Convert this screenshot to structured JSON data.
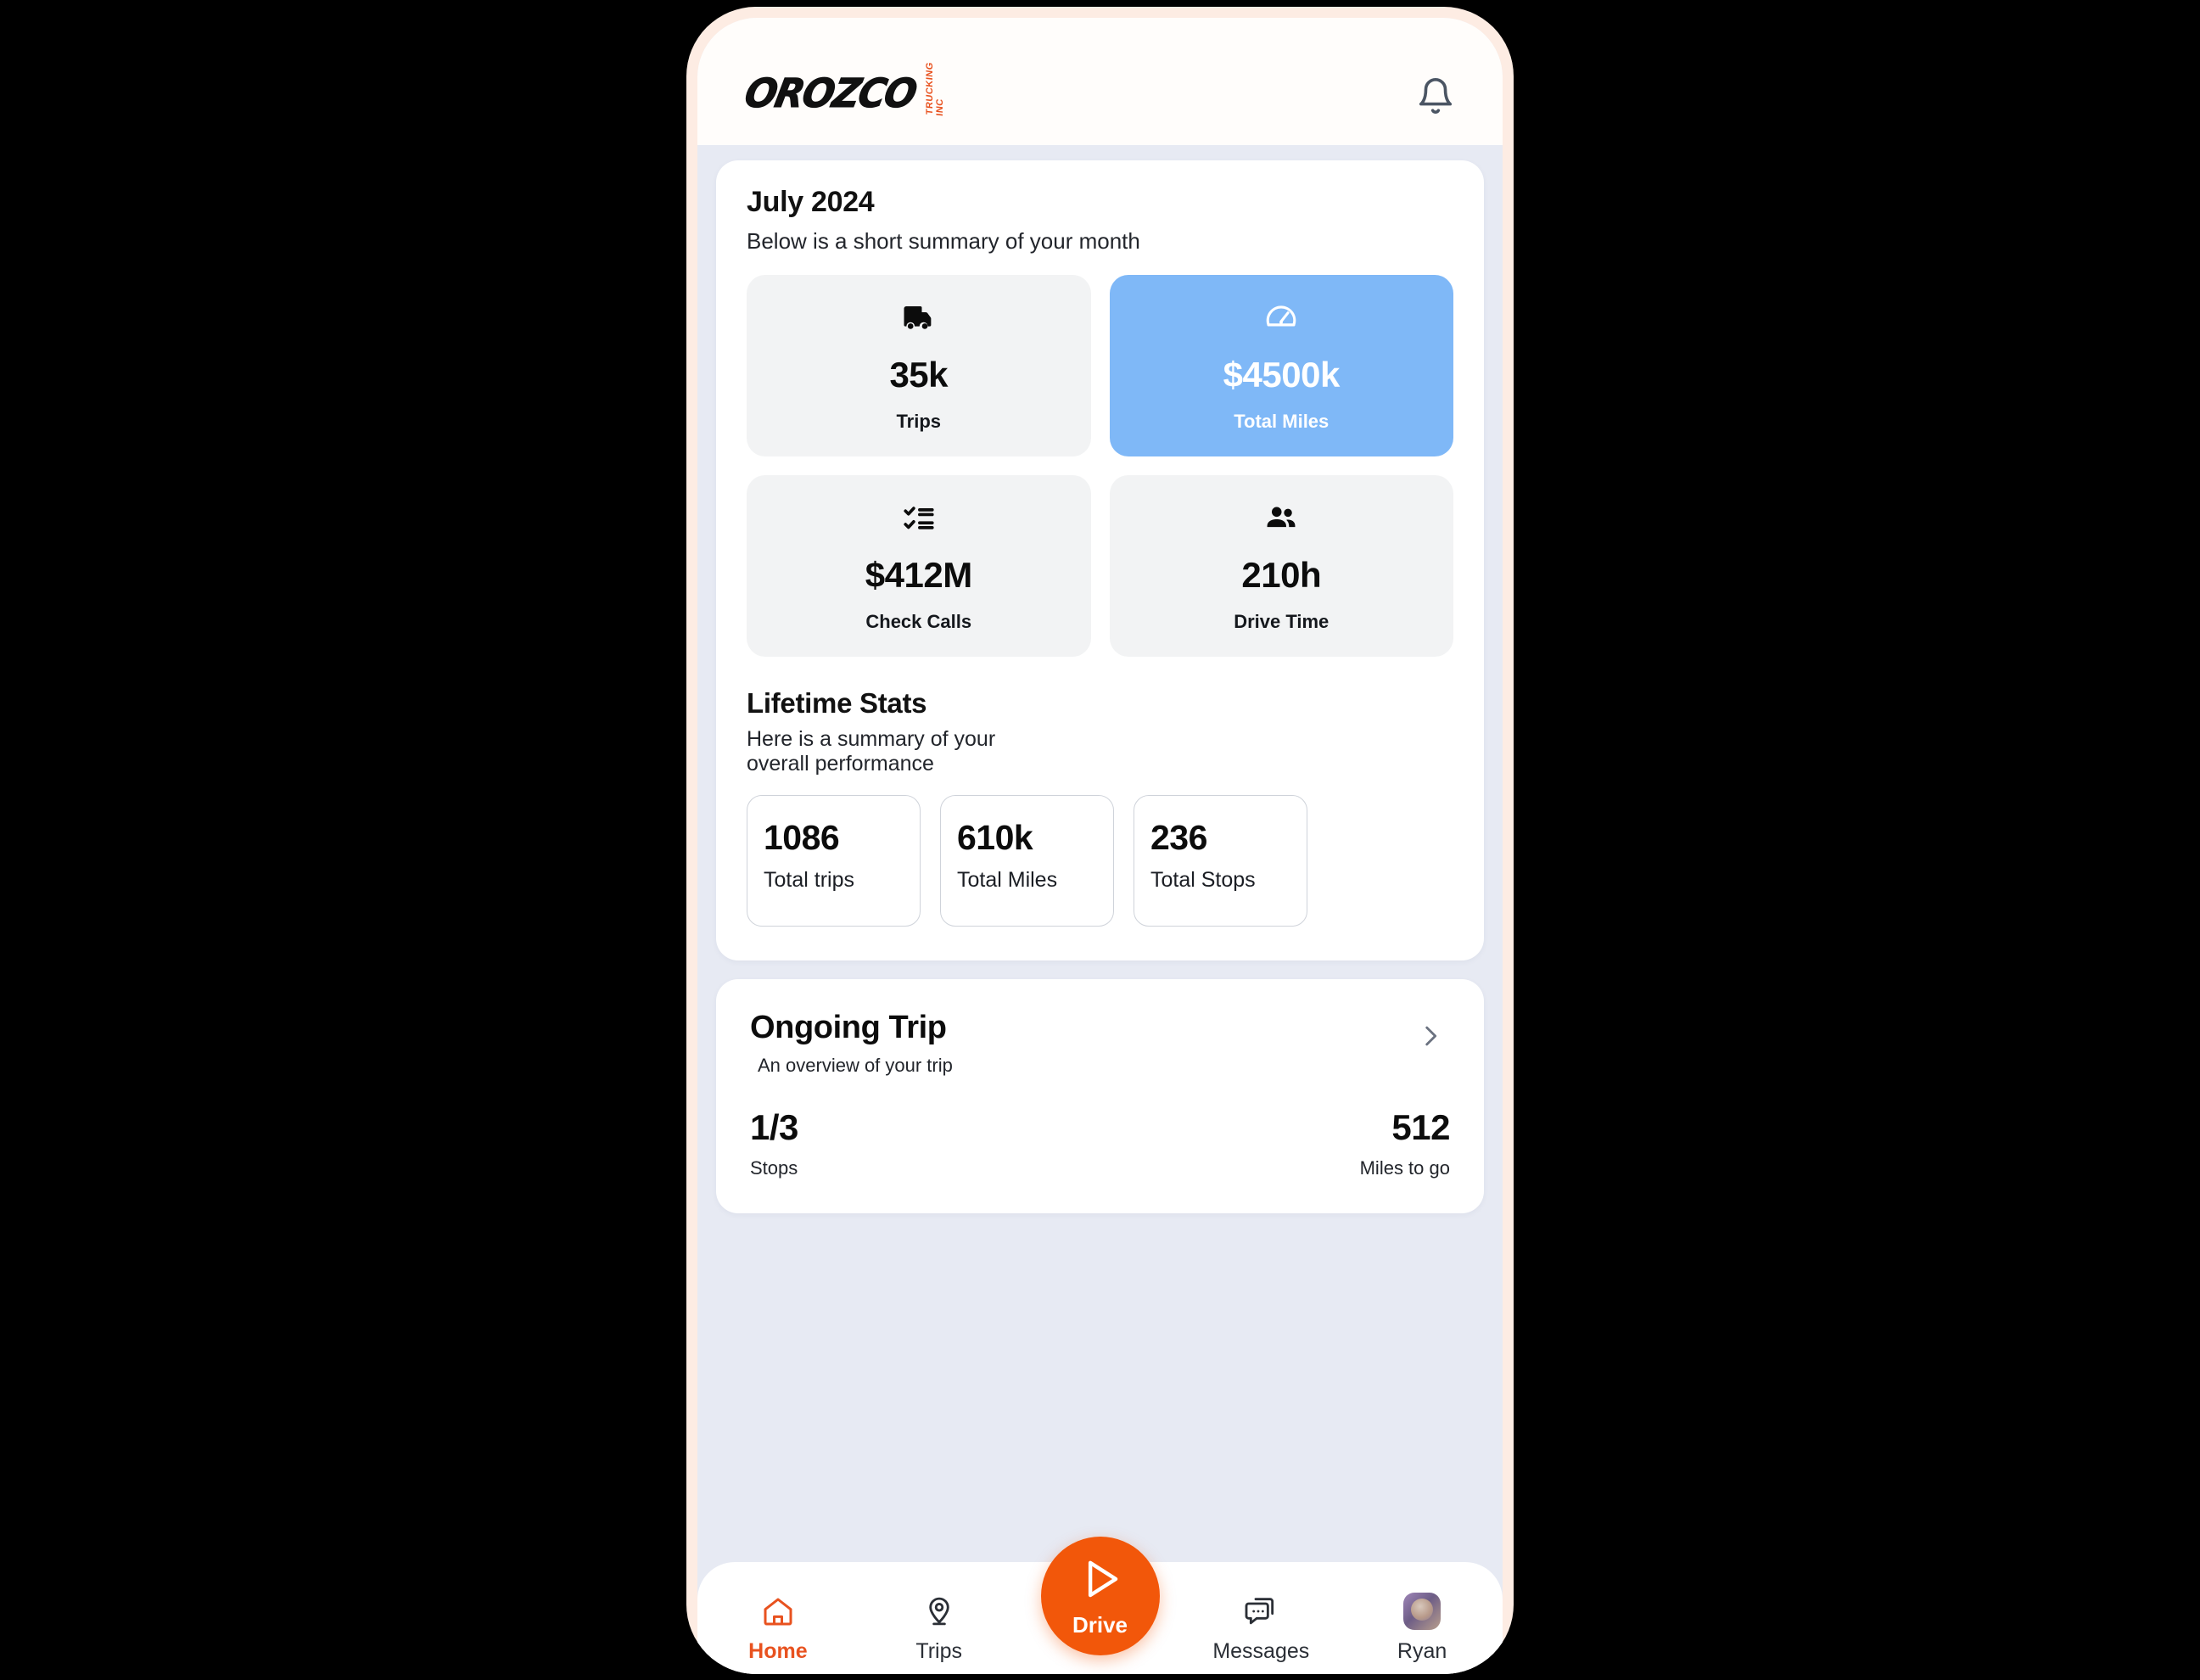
{
  "header": {
    "logo_text": "OROZCO",
    "logo_subtext": "TRUCKING INC",
    "bell_icon": "bell-icon"
  },
  "summary": {
    "title": "July 2024",
    "subtitle": "Below is a short summary of your month",
    "tiles": [
      {
        "icon": "truck-icon",
        "value": "35k",
        "label": "Trips"
      },
      {
        "icon": "speedometer-icon",
        "value": "$4500k",
        "label": "Total Miles"
      },
      {
        "icon": "checklist-icon",
        "value": "$412M",
        "label": "Check Calls"
      },
      {
        "icon": "people-icon",
        "value": "210h",
        "label": "Drive Time"
      }
    ]
  },
  "lifetime": {
    "title": "Lifetime Stats",
    "subtitle": "Here is a summary of your overall performance",
    "cards": [
      {
        "value": "1086",
        "label": "Total trips"
      },
      {
        "value": "610k",
        "label": "Total Miles"
      },
      {
        "value": "236",
        "label": "Total Stops"
      }
    ]
  },
  "ongoing": {
    "title": "Ongoing Trip",
    "subtitle": "An overview of your trip",
    "chevron_icon": "chevron-right-icon",
    "stops_value": "1/3",
    "stops_label": "Stops",
    "miles_value": "512",
    "miles_label": "Miles to go"
  },
  "nav": {
    "home_label": "Home",
    "trips_label": "Trips",
    "drive_label": "Drive",
    "messages_label": "Messages",
    "profile_label": "Ryan"
  },
  "colors": {
    "accent_orange": "#f2570a",
    "tile_blue": "#7fb8f7",
    "page_bg": "#e7eaf3",
    "frame": "#fdece3"
  }
}
